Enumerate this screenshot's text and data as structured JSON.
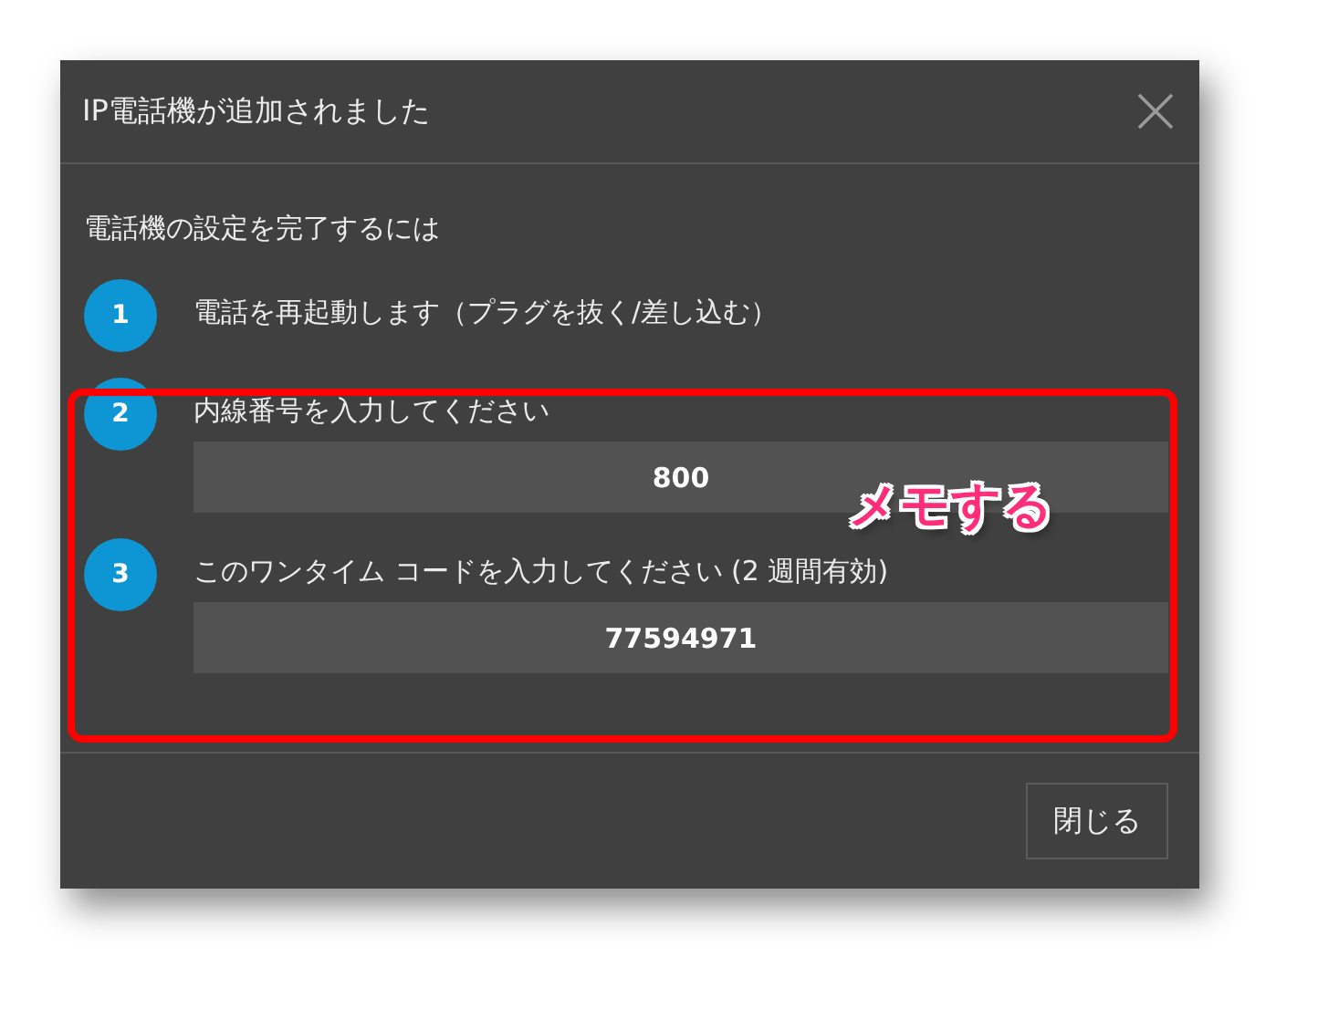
{
  "dialog": {
    "title": "IP電話機が追加されました",
    "intro": "電話機の設定を完了するには",
    "steps": [
      {
        "number": "1",
        "label": "電話を再起動します（プラグを抜く/差し込む）"
      },
      {
        "number": "2",
        "label": "内線番号を入力してください",
        "value": "800"
      },
      {
        "number": "3",
        "label": "このワンタイム コードを入力してください (2 週間有効)",
        "value": "77594971"
      }
    ],
    "buttons": [
      "閉じる"
    ]
  },
  "annotation": {
    "text": "メモする"
  }
}
